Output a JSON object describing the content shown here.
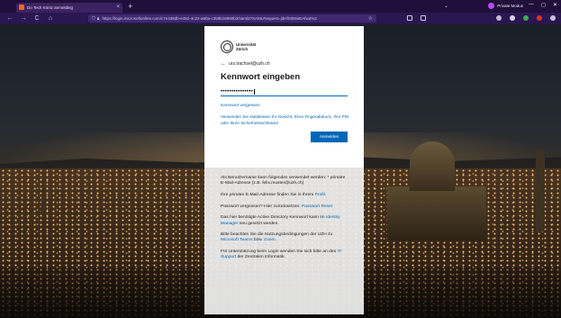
{
  "browser": {
    "tab_title": "Do Tech Köniz anmelding",
    "tab_close": "×",
    "new_tab": "+",
    "tab_list": "⌄",
    "private_label": "Private Modus",
    "window_controls": [
      "—",
      "◻",
      "✕"
    ],
    "url": "https://login.microsoftonline.com/c7e438db-e462-4c22-a90a-c358b16980b3/saml2?SAMLRequest=jdHfS0MwEAfwd%2",
    "nav": {
      "back": "←",
      "forward": "→",
      "reload": "C",
      "home": "⌂"
    },
    "url_star": "☆",
    "colors": {
      "tab_bar": "#1f0f3a",
      "toolbar": "#2a1650",
      "private_dot": "#b14df0"
    }
  },
  "login": {
    "logo_line1": "Universität",
    "logo_line2": "Zürich",
    "account": "urs.trachsel@uzh.ch",
    "back_arrow": "←",
    "heading": "Kennwort eingeben",
    "password_masked": "•••••••••••••••",
    "forgot_link": "Kennwort vergessen",
    "alt_signin": "Verwenden Sie stattdessen Ihr Gesicht, Ihren Fingerabdruck, Ihre PIN oder Ihren Sicherheitsschlüssel",
    "signin_button": "Anmelden",
    "accent_color": "#0067b8"
  },
  "info": {
    "p1": "Als Benutzername kann folgendes verwendet werden: * primäre E-Mail-Adresse (z.B. felix.muster@uzh.ch)",
    "p2_text": "Ihre primäre E-Mail-Adresse finden Sie in Ihrem",
    "p2_link": "Profil",
    "p2_end": ".",
    "p3_text": "Passwort vergessen? Hier zurücksetzen:",
    "p3_link": "Passwort Reset",
    "p4_text": "Das hier benötigte Active Directory Kennwort kann im",
    "p4_link": "Identity Manager",
    "p4_end": "neu gesetzt werden.",
    "p5_text": "Bitte beachten Sie die Nutzungsbedingungen der UZH zu",
    "p5_link1": "Microsoft Teams",
    "p5_mid": "bzw.",
    "p5_link2": "Zoom",
    "p5_end": ".",
    "p6_text": "Für Unterstützung beim Login wenden Sie sich bitte an den",
    "p6_link": "IT-Support",
    "p6_end": "der Zentralen Informatik."
  }
}
